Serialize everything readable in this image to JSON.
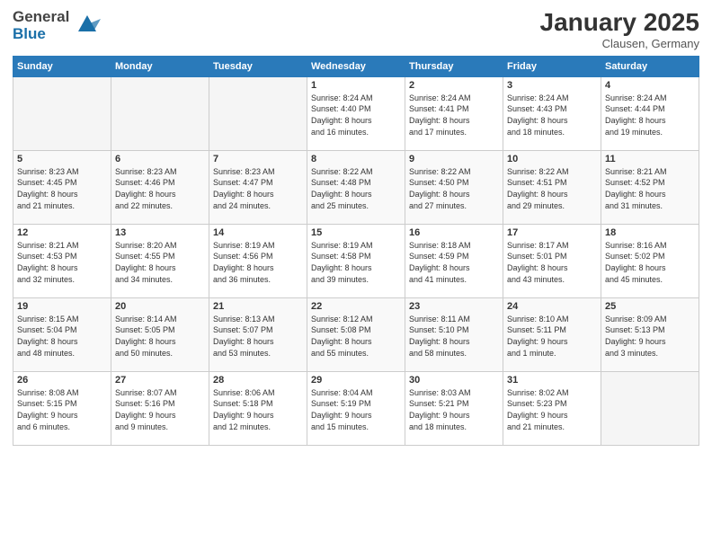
{
  "logo": {
    "general": "General",
    "blue": "Blue"
  },
  "header": {
    "month_year": "January 2025",
    "location": "Clausen, Germany"
  },
  "weekdays": [
    "Sunday",
    "Monday",
    "Tuesday",
    "Wednesday",
    "Thursday",
    "Friday",
    "Saturday"
  ],
  "weeks": [
    [
      {
        "day": "",
        "info": ""
      },
      {
        "day": "",
        "info": ""
      },
      {
        "day": "",
        "info": ""
      },
      {
        "day": "1",
        "info": "Sunrise: 8:24 AM\nSunset: 4:40 PM\nDaylight: 8 hours\nand 16 minutes."
      },
      {
        "day": "2",
        "info": "Sunrise: 8:24 AM\nSunset: 4:41 PM\nDaylight: 8 hours\nand 17 minutes."
      },
      {
        "day": "3",
        "info": "Sunrise: 8:24 AM\nSunset: 4:43 PM\nDaylight: 8 hours\nand 18 minutes."
      },
      {
        "day": "4",
        "info": "Sunrise: 8:24 AM\nSunset: 4:44 PM\nDaylight: 8 hours\nand 19 minutes."
      }
    ],
    [
      {
        "day": "5",
        "info": "Sunrise: 8:23 AM\nSunset: 4:45 PM\nDaylight: 8 hours\nand 21 minutes."
      },
      {
        "day": "6",
        "info": "Sunrise: 8:23 AM\nSunset: 4:46 PM\nDaylight: 8 hours\nand 22 minutes."
      },
      {
        "day": "7",
        "info": "Sunrise: 8:23 AM\nSunset: 4:47 PM\nDaylight: 8 hours\nand 24 minutes."
      },
      {
        "day": "8",
        "info": "Sunrise: 8:22 AM\nSunset: 4:48 PM\nDaylight: 8 hours\nand 25 minutes."
      },
      {
        "day": "9",
        "info": "Sunrise: 8:22 AM\nSunset: 4:50 PM\nDaylight: 8 hours\nand 27 minutes."
      },
      {
        "day": "10",
        "info": "Sunrise: 8:22 AM\nSunset: 4:51 PM\nDaylight: 8 hours\nand 29 minutes."
      },
      {
        "day": "11",
        "info": "Sunrise: 8:21 AM\nSunset: 4:52 PM\nDaylight: 8 hours\nand 31 minutes."
      }
    ],
    [
      {
        "day": "12",
        "info": "Sunrise: 8:21 AM\nSunset: 4:53 PM\nDaylight: 8 hours\nand 32 minutes."
      },
      {
        "day": "13",
        "info": "Sunrise: 8:20 AM\nSunset: 4:55 PM\nDaylight: 8 hours\nand 34 minutes."
      },
      {
        "day": "14",
        "info": "Sunrise: 8:19 AM\nSunset: 4:56 PM\nDaylight: 8 hours\nand 36 minutes."
      },
      {
        "day": "15",
        "info": "Sunrise: 8:19 AM\nSunset: 4:58 PM\nDaylight: 8 hours\nand 39 minutes."
      },
      {
        "day": "16",
        "info": "Sunrise: 8:18 AM\nSunset: 4:59 PM\nDaylight: 8 hours\nand 41 minutes."
      },
      {
        "day": "17",
        "info": "Sunrise: 8:17 AM\nSunset: 5:01 PM\nDaylight: 8 hours\nand 43 minutes."
      },
      {
        "day": "18",
        "info": "Sunrise: 8:16 AM\nSunset: 5:02 PM\nDaylight: 8 hours\nand 45 minutes."
      }
    ],
    [
      {
        "day": "19",
        "info": "Sunrise: 8:15 AM\nSunset: 5:04 PM\nDaylight: 8 hours\nand 48 minutes."
      },
      {
        "day": "20",
        "info": "Sunrise: 8:14 AM\nSunset: 5:05 PM\nDaylight: 8 hours\nand 50 minutes."
      },
      {
        "day": "21",
        "info": "Sunrise: 8:13 AM\nSunset: 5:07 PM\nDaylight: 8 hours\nand 53 minutes."
      },
      {
        "day": "22",
        "info": "Sunrise: 8:12 AM\nSunset: 5:08 PM\nDaylight: 8 hours\nand 55 minutes."
      },
      {
        "day": "23",
        "info": "Sunrise: 8:11 AM\nSunset: 5:10 PM\nDaylight: 8 hours\nand 58 minutes."
      },
      {
        "day": "24",
        "info": "Sunrise: 8:10 AM\nSunset: 5:11 PM\nDaylight: 9 hours\nand 1 minute."
      },
      {
        "day": "25",
        "info": "Sunrise: 8:09 AM\nSunset: 5:13 PM\nDaylight: 9 hours\nand 3 minutes."
      }
    ],
    [
      {
        "day": "26",
        "info": "Sunrise: 8:08 AM\nSunset: 5:15 PM\nDaylight: 9 hours\nand 6 minutes."
      },
      {
        "day": "27",
        "info": "Sunrise: 8:07 AM\nSunset: 5:16 PM\nDaylight: 9 hours\nand 9 minutes."
      },
      {
        "day": "28",
        "info": "Sunrise: 8:06 AM\nSunset: 5:18 PM\nDaylight: 9 hours\nand 12 minutes."
      },
      {
        "day": "29",
        "info": "Sunrise: 8:04 AM\nSunset: 5:19 PM\nDaylight: 9 hours\nand 15 minutes."
      },
      {
        "day": "30",
        "info": "Sunrise: 8:03 AM\nSunset: 5:21 PM\nDaylight: 9 hours\nand 18 minutes."
      },
      {
        "day": "31",
        "info": "Sunrise: 8:02 AM\nSunset: 5:23 PM\nDaylight: 9 hours\nand 21 minutes."
      },
      {
        "day": "",
        "info": ""
      }
    ]
  ]
}
